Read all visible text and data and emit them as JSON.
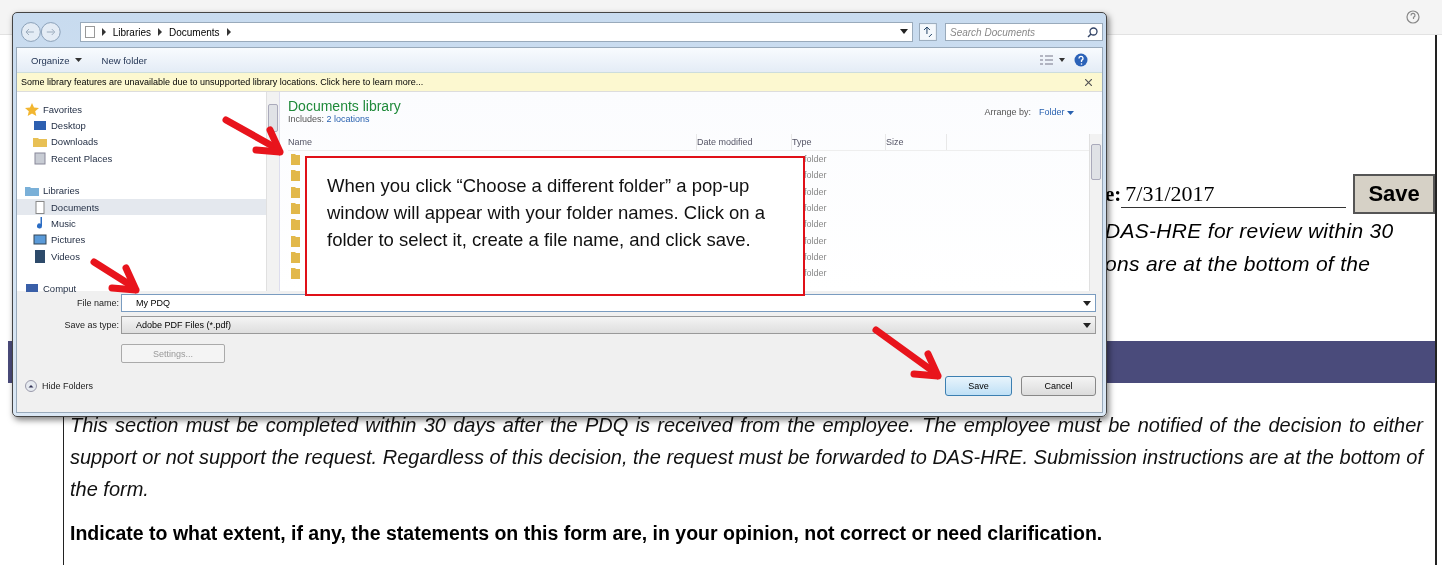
{
  "dialog": {
    "breadcrumb": [
      "Libraries",
      "Documents"
    ],
    "search": {
      "placeholder": "Search Documents"
    },
    "toolbar": [
      {
        "label": "Organize",
        "menu": true
      },
      {
        "label": "New folder",
        "menu": false
      }
    ],
    "info_bar": "Some library features are unavailable due to unsupported library locations. Click here to learn more...",
    "nav": [
      {
        "label": "Favorites",
        "selected": false,
        "children": [
          {
            "label": "Desktop",
            "selected": false
          },
          {
            "label": "Downloads",
            "selected": false
          },
          {
            "label": "Recent Places",
            "selected": false
          }
        ]
      },
      {
        "label": "Libraries",
        "selected": false,
        "children": [
          {
            "label": "Documents",
            "selected": true
          },
          {
            "label": "Music",
            "selected": false
          },
          {
            "label": "Pictures",
            "selected": false
          },
          {
            "label": "Videos",
            "selected": false
          }
        ]
      },
      {
        "label": "Comput",
        "selected": false
      }
    ],
    "library": {
      "title": "Documents library",
      "includes_label": "Includes:",
      "includes_link": "2 locations",
      "arrange_label": "Arrange by:",
      "arrange_value": "Folder"
    },
    "columns": [
      "Name",
      "Date modified",
      "Type",
      "Size"
    ],
    "rows": [
      {
        "type": "folder"
      },
      {
        "type": "folder"
      },
      {
        "type": "folder"
      },
      {
        "type": "folder"
      },
      {
        "type": "folder"
      },
      {
        "type": "folder"
      },
      {
        "type": "folder"
      },
      {
        "type": "folder"
      }
    ],
    "file_name": {
      "label": "File name:",
      "value": "My PDQ"
    },
    "save_as_type": {
      "label": "Save as type:",
      "value": "Adobe PDF Files (*.pdf)"
    },
    "settings_button": {
      "label": "Settings...",
      "disabled": true
    },
    "hide_folders": "Hide Folders",
    "buttons": [
      {
        "label": "Save",
        "default": true
      },
      {
        "label": "Cancel",
        "default": false
      }
    ]
  },
  "callout": "When you click “Choose a different folder” a pop-up window will appear with your folder names. Click on a folder to select it, create a file name, and click save.",
  "form": {
    "date_label": "e:",
    "date_value": "7/31/2017",
    "save_button": "Save",
    "notice_lines": [
      "DAS-HRE for review within 30",
      "ons are at the bottom of the"
    ],
    "section_text": "This section must be completed within 30 days after the PDQ is received from the employee. The employee must be notified of the decision to either support or not support the request. Regardless of this decision, the request must be forwarded to DAS-HRE. Submission instructions are at the bottom of the form.",
    "question": "Indicate to what extent, if any, the statements on this form are, in your opinion, not correct or need clarification."
  }
}
